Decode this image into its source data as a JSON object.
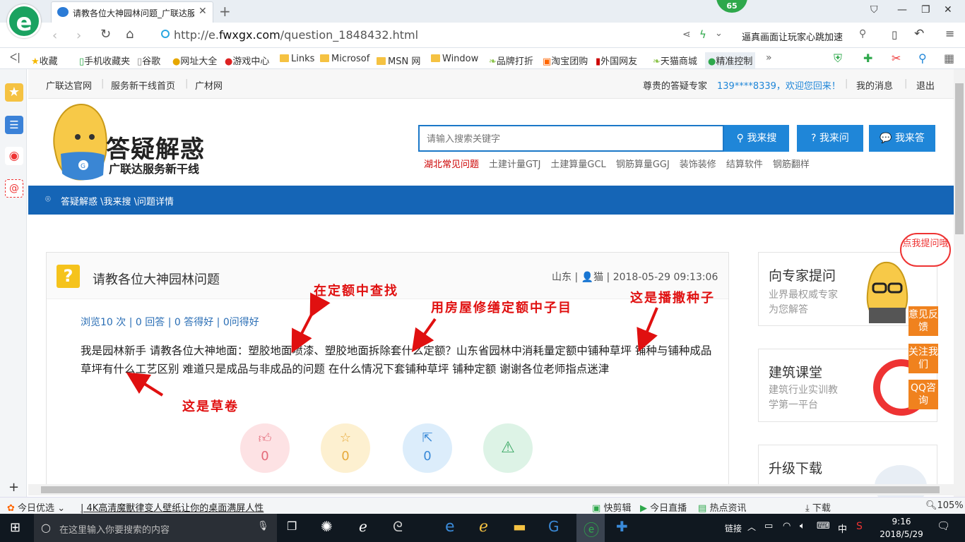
{
  "browser": {
    "tab_title": "请教各位大神园林问题_广联达服",
    "url_prefix": "http://e.",
    "url_domain": "fwxgx.com",
    "url_path": "/question_1848432.html",
    "badge": "65",
    "promo_text": "逼真画面让玩家心跳加速"
  },
  "favorites": [
    "收藏",
    "手机收藏夹",
    "谷歌",
    "网址大全",
    "游戏中心",
    "Links",
    "Microsof",
    "MSN 网",
    "Window",
    "品牌打折",
    "淘宝团购",
    "外国网友",
    "天猫商城",
    "精准控制"
  ],
  "topnav": {
    "links": [
      "广联达官网",
      "服务新干线首页",
      "广材网"
    ],
    "greeting": "尊贵的答疑专家",
    "user": "139****8339，欢迎您回来！",
    "messages": "我的消息",
    "logout": "退出"
  },
  "brand": {
    "title": "答疑解惑",
    "subtitle": "广联达服务新干线"
  },
  "search": {
    "placeholder": "请输入搜索关键字",
    "btn_search": "我来搜",
    "btn_ask": "我来问",
    "btn_answer": "我来答",
    "hot": [
      "湖北常见问题",
      "土建计量GTJ",
      "土建算量GCL",
      "钢筋算量GGJ",
      "装饰装修",
      "结算软件",
      "钢筋翻样"
    ]
  },
  "breadcrumb": "答疑解惑 \\我来搜 \\问题详情",
  "question": {
    "title": "请教各位大神园林问题",
    "region": "山东",
    "user": "猫",
    "datetime": "2018-05-29 09:13:06",
    "stats": "浏览10 次 | 0 回答 | 0 答得好 | 0问得好",
    "body": "我是园林新手 请教各位大神地面：塑胶地面喷漆、塑胶地面拆除套什么定额？山东省园林中消耗量定额中铺种草坪 铺种与铺种成品草坪有什么工艺区别 难道只是成品与非成品的问题 在什么情况下套铺种草坪 铺种定额 谢谢各位老师指点迷津",
    "votes": [
      "0",
      "0",
      "0"
    ]
  },
  "annotations": [
    "在定额中查找",
    "用房屋修缮定额中子目",
    "这是播撒种子",
    "这是草卷"
  ],
  "sidebar": {
    "expert_title": "向专家提问",
    "expert_sub1": "业界最权威专家",
    "expert_sub2": "为您解答",
    "bubble": "点我提问哦",
    "class_title": "建筑课堂",
    "class_sub1": "建筑行业实训教",
    "class_sub2": "学第一平台",
    "download_title": "升级下载",
    "float_feedback": "意见反馈",
    "float_follow": "关注我们",
    "float_qq": "QQ咨询"
  },
  "statusbar": {
    "today": "今日优选",
    "news": "4K高清魔獸律变人壁纸让你的桌面满屏人性",
    "items": [
      "快剪辑",
      "今日直播",
      "热点资讯",
      "下载"
    ],
    "zoom": "105%"
  },
  "taskbar": {
    "search_placeholder": "在这里输入你要搜索的内容",
    "tray_link": "链接",
    "ime": "中",
    "time": "9:16",
    "date": "2018/5/29"
  }
}
